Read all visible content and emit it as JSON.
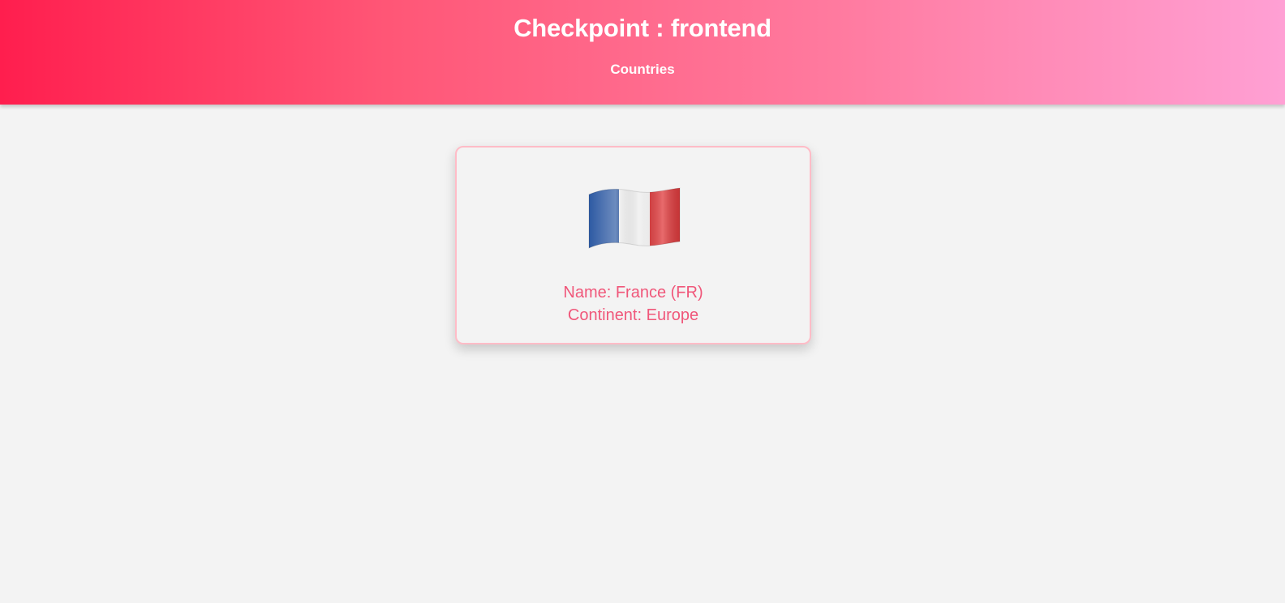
{
  "header": {
    "title": "Checkpoint : frontend",
    "nav": [
      "Countries"
    ]
  },
  "country_card": {
    "flag_icon": "france-flag-icon",
    "name_line": "Name: France (FR)",
    "continent_line": "Continent: Europe"
  },
  "colors": {
    "header_gradient_start": "#ff1e4e",
    "header_gradient_end": "#ffa0d4",
    "card_text": "#f0577a",
    "card_border": "#ffbcc7",
    "page_background": "#f3f3f3"
  }
}
